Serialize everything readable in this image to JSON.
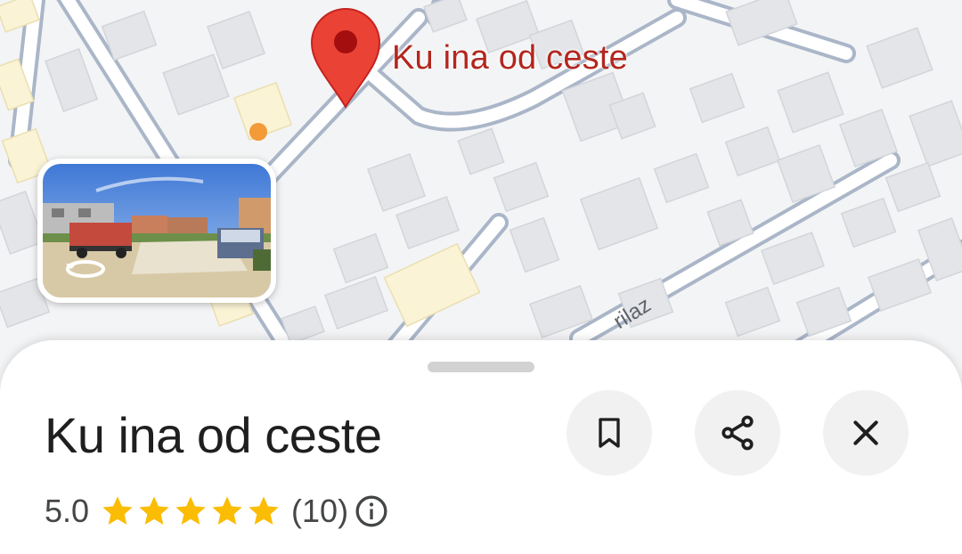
{
  "map": {
    "pin_label": "Ku  ina od ceste",
    "street_label": "rilaz",
    "colors": {
      "background": "#f1f3f4",
      "pin": "#ea4335",
      "poi": "#f29b38"
    }
  },
  "street_view": {
    "icon": "rotate-360-icon"
  },
  "place": {
    "name": "Ku  ina od ceste",
    "rating": "5.0",
    "stars": 5,
    "review_count": "(10)"
  },
  "actions": {
    "save_icon": "bookmark-icon",
    "share_icon": "share-icon",
    "close_icon": "close-icon"
  },
  "info_icon": "info-icon",
  "colors": {
    "star": "#fbbc04",
    "text": "#1f1f1f",
    "subtext": "#444746"
  }
}
